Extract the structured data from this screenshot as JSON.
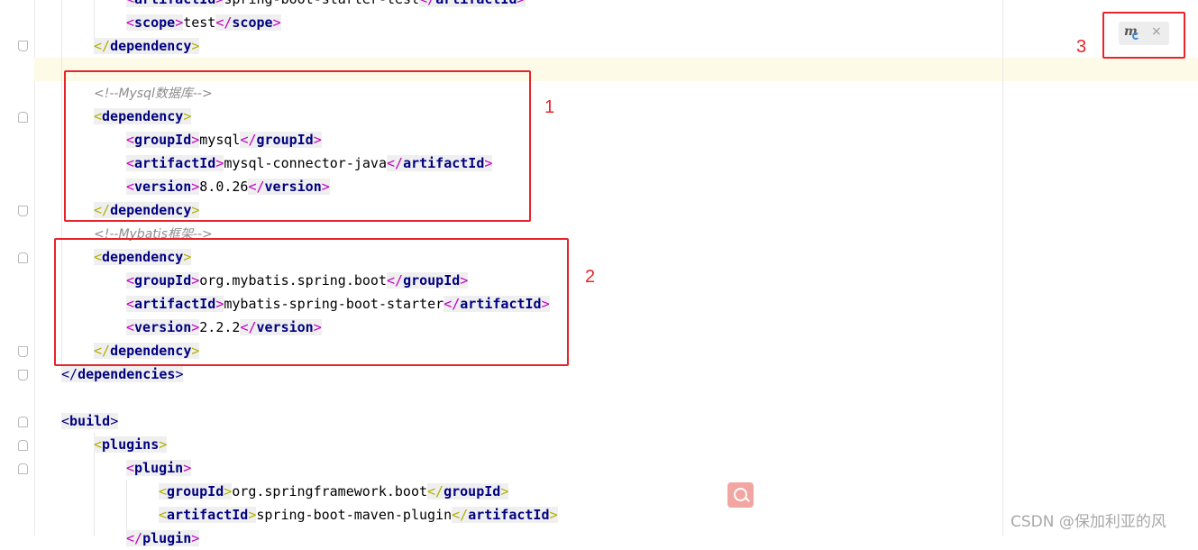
{
  "editor": {
    "lines": [
      {
        "id": "l0",
        "parts": [
          [
            "t",
            "<"
          ],
          [
            "tag",
            "artifactId"
          ],
          [
            "t",
            ">"
          ],
          [
            "v",
            "spring-boot-starter-test"
          ],
          [
            "t",
            "</"
          ],
          [
            "tag",
            "artifactId"
          ],
          [
            "t",
            ">"
          ]
        ]
      },
      {
        "id": "l1",
        "parts": [
          [
            "t",
            "<"
          ],
          [
            "tag",
            "scope"
          ],
          [
            "t",
            ">"
          ],
          [
            "v",
            "test"
          ],
          [
            "t",
            "</"
          ],
          [
            "tag",
            "scope"
          ],
          [
            "t",
            ">"
          ]
        ]
      },
      {
        "id": "l2",
        "parts": [
          [
            "to",
            "</"
          ],
          [
            "tag",
            "dependency"
          ],
          [
            "to",
            ">"
          ]
        ]
      },
      {
        "id": "l3",
        "parts": []
      },
      {
        "id": "l4",
        "parts": [
          [
            "c",
            "<!--Mysql数据库-->"
          ]
        ]
      },
      {
        "id": "l5",
        "parts": [
          [
            "to",
            "<"
          ],
          [
            "tag",
            "dependency"
          ],
          [
            "to",
            ">"
          ]
        ]
      },
      {
        "id": "l6",
        "parts": [
          [
            "t",
            "<"
          ],
          [
            "tag",
            "groupId"
          ],
          [
            "t",
            ">"
          ],
          [
            "v",
            "mysql"
          ],
          [
            "t",
            "</"
          ],
          [
            "tag",
            "groupId"
          ],
          [
            "t",
            ">"
          ]
        ]
      },
      {
        "id": "l7",
        "parts": [
          [
            "t",
            "<"
          ],
          [
            "tag",
            "artifactId"
          ],
          [
            "t",
            ">"
          ],
          [
            "v",
            "mysql-connector-java"
          ],
          [
            "t",
            "</"
          ],
          [
            "tag",
            "artifactId"
          ],
          [
            "t",
            ">"
          ]
        ]
      },
      {
        "id": "l8",
        "parts": [
          [
            "t",
            "<"
          ],
          [
            "tag",
            "version"
          ],
          [
            "t",
            ">"
          ],
          [
            "v",
            "8.0.26"
          ],
          [
            "t",
            "</"
          ],
          [
            "tag",
            "version"
          ],
          [
            "t",
            ">"
          ]
        ]
      },
      {
        "id": "l9",
        "parts": [
          [
            "to",
            "</"
          ],
          [
            "tag",
            "dependency"
          ],
          [
            "to",
            ">"
          ]
        ]
      },
      {
        "id": "l10",
        "parts": [
          [
            "c",
            "<!--Mybatis框架-->"
          ]
        ]
      },
      {
        "id": "l11",
        "parts": [
          [
            "to",
            "<"
          ],
          [
            "tag",
            "dependency"
          ],
          [
            "to",
            ">"
          ]
        ]
      },
      {
        "id": "l12",
        "parts": [
          [
            "t",
            "<"
          ],
          [
            "tag",
            "groupId"
          ],
          [
            "t",
            ">"
          ],
          [
            "v",
            "org.mybatis.spring.boot"
          ],
          [
            "t",
            "</"
          ],
          [
            "tag",
            "groupId"
          ],
          [
            "t",
            ">"
          ]
        ]
      },
      {
        "id": "l13",
        "parts": [
          [
            "t",
            "<"
          ],
          [
            "tag",
            "artifactId"
          ],
          [
            "t",
            ">"
          ],
          [
            "v",
            "mybatis-spring-boot-starter"
          ],
          [
            "t",
            "</"
          ],
          [
            "tag",
            "artifactId"
          ],
          [
            "t",
            ">"
          ]
        ]
      },
      {
        "id": "l14",
        "parts": [
          [
            "t",
            "<"
          ],
          [
            "tag",
            "version"
          ],
          [
            "t",
            ">"
          ],
          [
            "v",
            "2.2.2"
          ],
          [
            "t",
            "</"
          ],
          [
            "tag",
            "version"
          ],
          [
            "t",
            ">"
          ]
        ]
      },
      {
        "id": "l15",
        "parts": [
          [
            "to",
            "</"
          ],
          [
            "tag",
            "dependency"
          ],
          [
            "to",
            ">"
          ]
        ]
      },
      {
        "id": "l16",
        "parts": [
          [
            "tb",
            "</"
          ],
          [
            "tag",
            "dependencies"
          ],
          [
            "tb",
            ">"
          ]
        ]
      },
      {
        "id": "l17",
        "parts": []
      },
      {
        "id": "l18",
        "parts": [
          [
            "tb",
            "<"
          ],
          [
            "tag",
            "build"
          ],
          [
            "tb",
            ">"
          ]
        ]
      },
      {
        "id": "l19",
        "parts": [
          [
            "to",
            "<"
          ],
          [
            "tag",
            "plugins"
          ],
          [
            "to",
            ">"
          ]
        ]
      },
      {
        "id": "l20",
        "parts": [
          [
            "tp",
            "<"
          ],
          [
            "tag",
            "plugin"
          ],
          [
            "tp",
            ">"
          ]
        ]
      },
      {
        "id": "l21",
        "parts": [
          [
            "to",
            "<"
          ],
          [
            "tag",
            "groupId"
          ],
          [
            "to",
            ">"
          ],
          [
            "v",
            "org.springframework.boot"
          ],
          [
            "to",
            "</"
          ],
          [
            "tag",
            "groupId"
          ],
          [
            "to",
            ">"
          ]
        ]
      },
      {
        "id": "l22",
        "parts": [
          [
            "to",
            "<"
          ],
          [
            "tag",
            "artifactId"
          ],
          [
            "to",
            ">"
          ],
          [
            "v",
            "spring-boot-maven-plugin"
          ],
          [
            "to",
            "</"
          ],
          [
            "tag",
            "artifactId"
          ],
          [
            "to",
            ">"
          ]
        ]
      },
      {
        "id": "l23",
        "parts": [
          [
            "tp",
            "</"
          ],
          [
            "tag",
            "plugin"
          ],
          [
            "tp",
            ">"
          ]
        ]
      }
    ]
  },
  "annotations": {
    "label_1": "1",
    "label_2": "2",
    "label_3": "3"
  },
  "maven_notification": {
    "icon": "maven-reload-icon",
    "close_label": "×"
  },
  "search_button": {
    "icon": "search-icon"
  },
  "watermark": "CSDN @保加利亚的风",
  "colors": {
    "tag_name": "#000080",
    "bracket_magenta": "#c000c0",
    "bracket_olive": "#b0b000",
    "comment": "#8c8c8c",
    "annotation_red": "#e8232a",
    "current_line": "#fdfbe8"
  }
}
